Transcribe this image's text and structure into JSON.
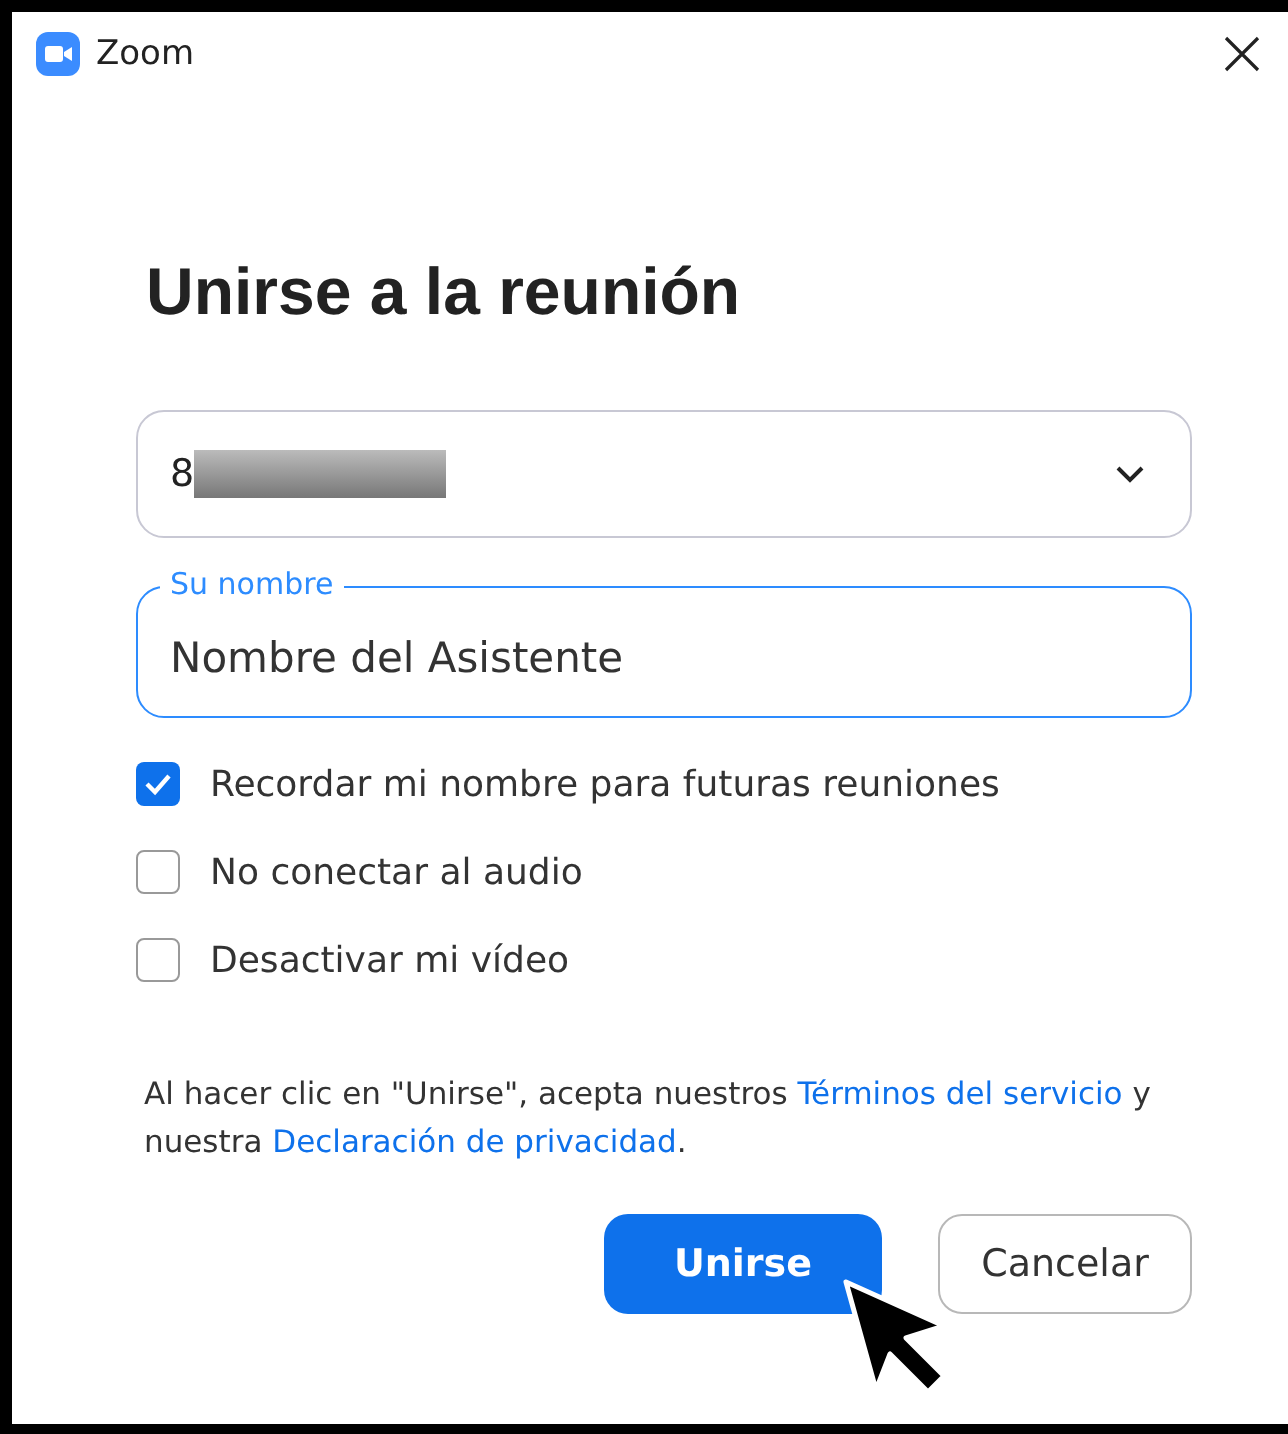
{
  "window": {
    "title": "Zoom"
  },
  "heading": "Unirse a la reunión",
  "meeting_field": {
    "value": "8",
    "redacted": true
  },
  "name_field": {
    "label": "Su nombre",
    "value": "Nombre del Asistente",
    "focused": true
  },
  "options": [
    {
      "label": "Recordar mi nombre para futuras reuniones",
      "checked": true
    },
    {
      "label": "No conectar al audio",
      "checked": false
    },
    {
      "label": "Desactivar mi vídeo",
      "checked": false
    }
  ],
  "legal": [
    {
      "kind": "text",
      "text": "Al hacer clic en \"Unirse\", acepta nuestros "
    },
    {
      "kind": "link",
      "text": "Términos del servicio"
    },
    {
      "kind": "text",
      "text": " y nuestra "
    },
    {
      "kind": "link",
      "text": "Declaración de privacidad"
    },
    {
      "kind": "text",
      "text": "."
    }
  ],
  "buttons": [
    {
      "label": "Unirse",
      "kind": "primary"
    },
    {
      "label": "Cancelar",
      "kind": "secondary"
    }
  ]
}
